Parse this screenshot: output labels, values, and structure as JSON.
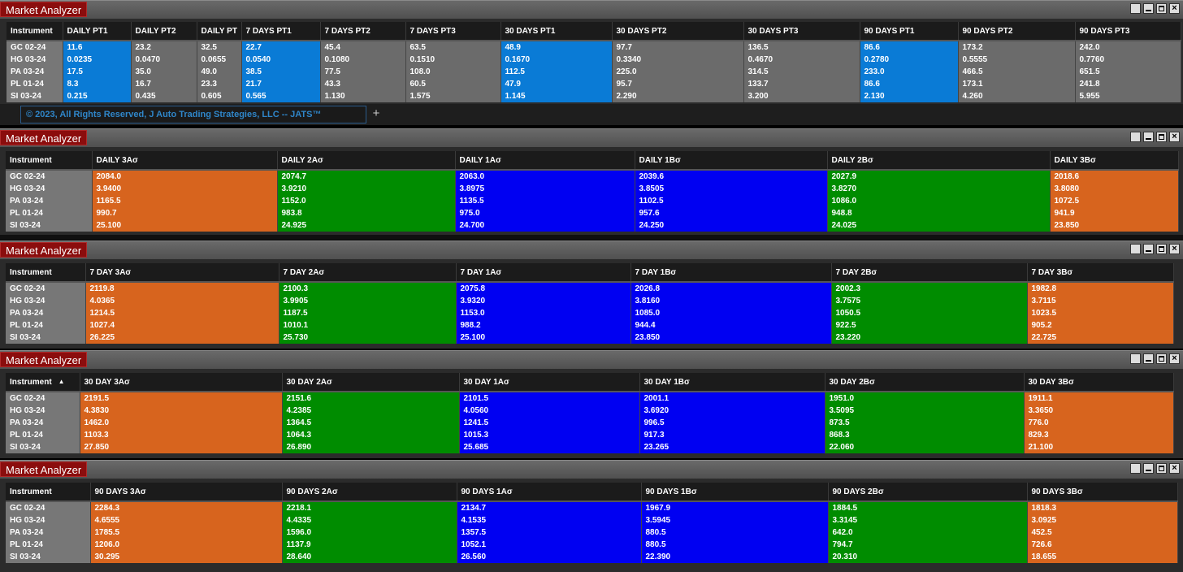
{
  "windows": [
    {
      "id": "w1",
      "title": "Market Analyzer",
      "columns": [
        "Instrument",
        "DAILY PT1",
        "DAILY PT2",
        "DAILY PT",
        "7 DAYS PT1",
        "7 DAYS PT2",
        "7 DAYS PT3",
        "30 DAYS PT1",
        "30 DAYS PT2",
        "30 DAYS PT3",
        "90 DAYS PT1",
        "90 DAYS PT2",
        "90 DAYS PT3"
      ],
      "instruments": [
        "GC 02-24",
        "HG 03-24",
        "PA 03-24",
        "PL 01-24",
        "SI 03-24"
      ],
      "rows": [
        [
          "11.6",
          "23.2",
          "32.5",
          "22.7",
          "45.4",
          "63.5",
          "48.9",
          "97.7",
          "136.5",
          "86.6",
          "173.2",
          "242.0"
        ],
        [
          "0.0235",
          "0.0470",
          "0.0655",
          "0.0540",
          "0.1080",
          "0.1510",
          "0.1670",
          "0.3340",
          "0.4670",
          "0.2780",
          "0.5555",
          "0.7760"
        ],
        [
          "17.5",
          "35.0",
          "49.0",
          "38.5",
          "77.5",
          "108.0",
          "112.5",
          "225.0",
          "314.5",
          "233.0",
          "466.5",
          "651.5"
        ],
        [
          "8.3",
          "16.7",
          "23.3",
          "21.7",
          "43.3",
          "60.5",
          "47.9",
          "95.7",
          "133.7",
          "86.6",
          "173.1",
          "241.8"
        ],
        [
          "0.215",
          "0.435",
          "0.605",
          "0.565",
          "1.130",
          "1.575",
          "1.145",
          "2.290",
          "3.200",
          "2.130",
          "4.260",
          "5.955"
        ]
      ],
      "footer": {
        "copyright": "© 2023, All Rights Reserved, J Auto Trading Strategies, LLC -- JATS™",
        "add_tab": "+"
      }
    },
    {
      "id": "w2",
      "title": "Market Analyzer",
      "columns": [
        "Instrument",
        "DAILY 3Aσ",
        "DAILY 2Aσ",
        "DAILY 1Aσ",
        "DAILY 1Bσ",
        "DAILY 2Bσ",
        "DAILY 3Bσ"
      ],
      "instruments": [
        "GC 02-24",
        "HG 03-24",
        "PA 03-24",
        "PL 01-24",
        "SI 03-24"
      ],
      "rows": [
        [
          "2084.0",
          "2074.7",
          "2063.0",
          "2039.6",
          "2027.9",
          "2018.6"
        ],
        [
          "3.9400",
          "3.9210",
          "3.8975",
          "3.8505",
          "3.8270",
          "3.8080"
        ],
        [
          "1165.5",
          "1152.0",
          "1135.5",
          "1102.5",
          "1086.0",
          "1072.5"
        ],
        [
          "990.7",
          "983.8",
          "975.0",
          "957.6",
          "948.8",
          "941.9"
        ],
        [
          "25.100",
          "24.925",
          "24.700",
          "24.250",
          "24.025",
          "23.850"
        ]
      ]
    },
    {
      "id": "w3",
      "title": "Market Analyzer",
      "columns": [
        "Instrument",
        "7 DAY 3Aσ",
        "7 DAY 2Aσ",
        "7 DAY 1Aσ",
        "7 DAY 1Bσ",
        "7 DAY 2Bσ",
        "7 DAY 3Bσ"
      ],
      "instruments": [
        "GC 02-24",
        "HG 03-24",
        "PA 03-24",
        "PL 01-24",
        "SI 03-24"
      ],
      "rows": [
        [
          "2119.8",
          "2100.3",
          "2075.8",
          "2026.8",
          "2002.3",
          "1982.8"
        ],
        [
          "4.0365",
          "3.9905",
          "3.9320",
          "3.8160",
          "3.7575",
          "3.7115"
        ],
        [
          "1214.5",
          "1187.5",
          "1153.0",
          "1085.0",
          "1050.5",
          "1023.5"
        ],
        [
          "1027.4",
          "1010.1",
          "988.2",
          "944.4",
          "922.5",
          "905.2"
        ],
        [
          "26.225",
          "25.730",
          "25.100",
          "23.850",
          "23.220",
          "22.725"
        ]
      ]
    },
    {
      "id": "w4",
      "title": "Market Analyzer",
      "columns": [
        "Instrument",
        "30 DAY 3Aσ",
        "30 DAY 2Aσ",
        "30 DAY 1Aσ",
        "30 DAY 1Bσ",
        "30 DAY 2Bσ",
        "30 DAY 3Bσ"
      ],
      "instruments": [
        "GC 02-24",
        "HG 03-24",
        "PA 03-24",
        "PL 01-24",
        "SI 03-24"
      ],
      "rows": [
        [
          "2191.5",
          "2151.6",
          "2101.5",
          "2001.1",
          "1951.0",
          "1911.1"
        ],
        [
          "4.3830",
          "4.2385",
          "4.0560",
          "3.6920",
          "3.5095",
          "3.3650"
        ],
        [
          "1462.0",
          "1364.5",
          "1241.5",
          "996.5",
          "873.5",
          "776.0"
        ],
        [
          "1103.3",
          "1064.3",
          "1015.3",
          "917.3",
          "868.3",
          "829.3"
        ],
        [
          "27.850",
          "26.890",
          "25.685",
          "23.265",
          "22.060",
          "21.100"
        ]
      ]
    },
    {
      "id": "w5",
      "title": "Market Analyzer",
      "columns": [
        "Instrument",
        "90 DAYS 3Aσ",
        "90 DAYS 2Aσ",
        "90 DAYS 1Aσ",
        "90 DAYS 1Bσ",
        "90 DAYS 2Bσ",
        "90 DAYS 3Bσ"
      ],
      "instruments": [
        "GC 02-24",
        "HG 03-24",
        "PA 03-24",
        "PL 01-24",
        "SI 03-24"
      ],
      "rows": [
        [
          "2284.3",
          "2218.1",
          "2134.7",
          "1967.9",
          "1884.5",
          "1818.3"
        ],
        [
          "4.6555",
          "4.4335",
          "4.1535",
          "3.5945",
          "3.3145",
          "3.0925"
        ],
        [
          "1785.5",
          "1596.0",
          "1357.5",
          "880.5",
          "642.0",
          "452.5"
        ],
        [
          "1206.0",
          "1137.9",
          "1052.1",
          "880.5",
          "794.7",
          "726.6"
        ],
        [
          "30.295",
          "28.640",
          "26.560",
          "22.390",
          "20.310",
          "18.655"
        ]
      ]
    }
  ],
  "colors": {
    "orange": "#d7641e",
    "green": "#008c00",
    "blue": "#0000f2",
    "light_blue": "#0a7bd6",
    "gray": "#6b6b6b",
    "title_red": "#8b0d0d"
  },
  "icons": [
    "restore-icon",
    "minimize-icon",
    "maximize-icon",
    "close-icon",
    "sort-ascending-icon"
  ]
}
